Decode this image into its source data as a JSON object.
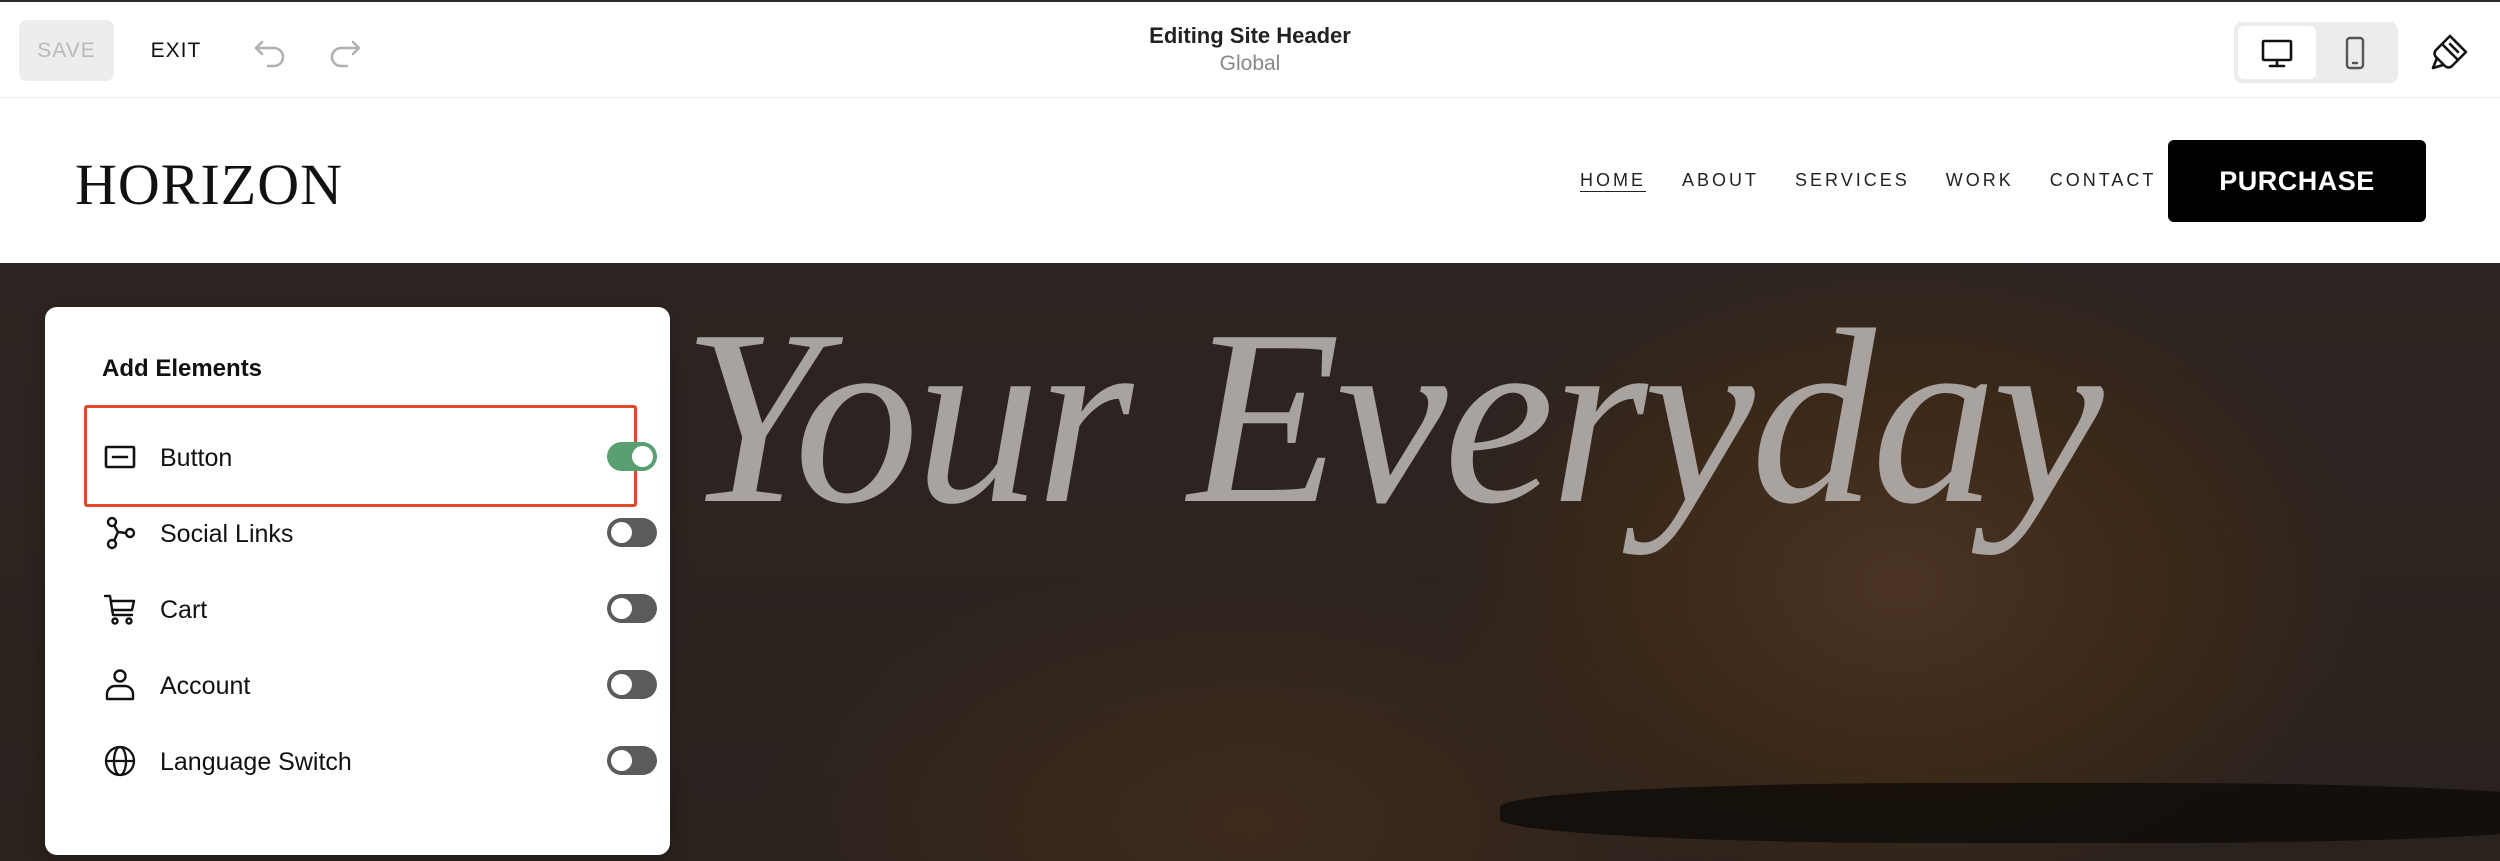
{
  "topbar": {
    "save_label": "SAVE",
    "exit_label": "EXIT",
    "title": "Editing Site Header",
    "subtitle": "Global",
    "undo_icon": "undo-icon",
    "redo_icon": "redo-icon",
    "device_modes": [
      "desktop",
      "mobile"
    ],
    "active_device": "desktop",
    "style_icon": "paintbrush-icon"
  },
  "site": {
    "logo": "HORIZON",
    "nav": [
      {
        "label": "HOME",
        "current": true
      },
      {
        "label": "ABOUT",
        "current": false
      },
      {
        "label": "SERVICES",
        "current": false
      },
      {
        "label": "WORK",
        "current": false
      },
      {
        "label": "CONTACT",
        "current": false
      }
    ],
    "cta_label": "PURCHASE"
  },
  "hero": {
    "headline_visible": "ate Your Everyday"
  },
  "panel": {
    "title": "Add Elements",
    "items": [
      {
        "label": "Button",
        "icon": "button-icon",
        "enabled": true,
        "highlighted": true
      },
      {
        "label": "Social Links",
        "icon": "share-nodes-icon",
        "enabled": false
      },
      {
        "label": "Cart",
        "icon": "cart-icon",
        "enabled": false
      },
      {
        "label": "Account",
        "icon": "person-icon",
        "enabled": false
      },
      {
        "label": "Language Switch",
        "icon": "globe-icon",
        "enabled": false
      }
    ]
  },
  "colors": {
    "highlight": "#e0492c",
    "toggle_on": "#5a9f72",
    "toggle_off": "#5b5b5b",
    "cta_bg": "#000000"
  }
}
